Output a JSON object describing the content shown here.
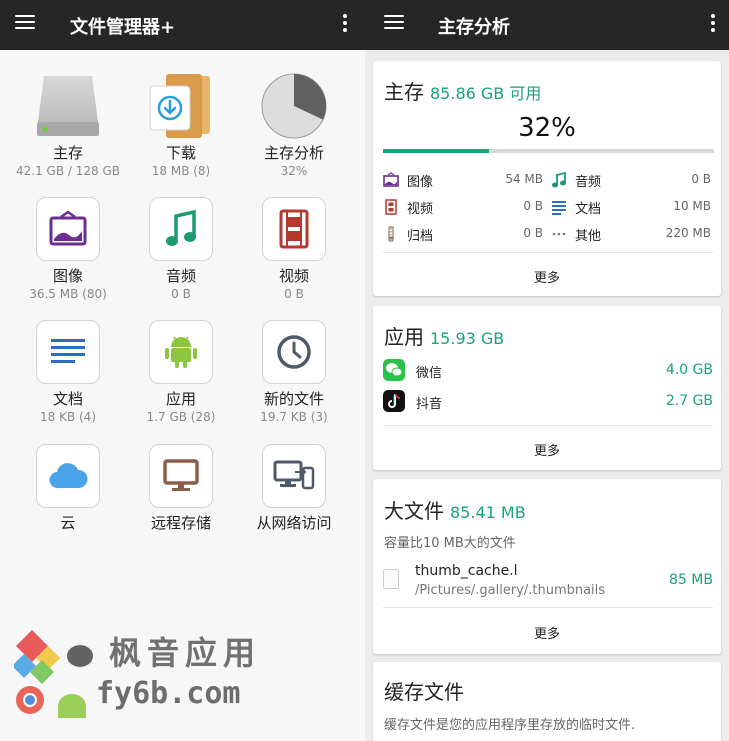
{
  "left": {
    "title": "文件管理器+",
    "tiles": [
      {
        "name": "主存",
        "sub": "42.1 GB / 128 GB"
      },
      {
        "name": "下载",
        "sub": "18 MB (8)"
      },
      {
        "name": "主存分析",
        "sub": "32%"
      },
      {
        "name": "图像",
        "sub": "36.5 MB (80)"
      },
      {
        "name": "音频",
        "sub": "0 B"
      },
      {
        "name": "视频",
        "sub": "0 B"
      },
      {
        "name": "文档",
        "sub": "18 KB (4)"
      },
      {
        "name": "应用",
        "sub": "1.7 GB (28)"
      },
      {
        "name": "新的文件",
        "sub": "19.7 KB (3)"
      },
      {
        "name": "云",
        "sub": ""
      },
      {
        "name": "远程存储",
        "sub": ""
      },
      {
        "name": "从网络访问",
        "sub": ""
      }
    ],
    "pie_used_fraction": 0.32
  },
  "watermark": {
    "brand_cn": "枫音应用",
    "brand_en": "fy6b.com"
  },
  "right": {
    "title": "主存分析",
    "storage": {
      "title": "主存",
      "available": "85.86 GB 可用",
      "percent": "32%",
      "used_fraction": 0.32,
      "categories": [
        {
          "label": "图像",
          "size": "54 MB"
        },
        {
          "label": "音频",
          "size": "0 B"
        },
        {
          "label": "视频",
          "size": "0 B"
        },
        {
          "label": "文档",
          "size": "10 MB"
        },
        {
          "label": "归档",
          "size": "0 B"
        },
        {
          "label": "其他",
          "size": "220 MB"
        }
      ],
      "more": "更多"
    },
    "apps": {
      "title": "应用",
      "total": "15.93 GB",
      "items": [
        {
          "label": "微信",
          "size": "4.0 GB"
        },
        {
          "label": "抖音",
          "size": "2.7 GB"
        }
      ],
      "more": "更多"
    },
    "large_files": {
      "title": "大文件",
      "total": "85.41 MB",
      "desc": "容量比10 MB大的文件",
      "file": {
        "name": "thumb_cache.l",
        "path": "/Pictures/.gallery/.thumbnails",
        "size": "85 MB"
      },
      "more": "更多"
    },
    "cache": {
      "title": "缓存文件",
      "desc": "缓存文件是您的应用程序里存放的临时文件."
    }
  },
  "colors": {
    "accent": "#1aa37a",
    "topbar": "#262626",
    "purple": "#6b2f8f",
    "green": "#1a9b6e",
    "red": "#b53a2e",
    "blue": "#2a6fc0",
    "android": "#8cc63e",
    "cloud": "#4aa3e8"
  }
}
